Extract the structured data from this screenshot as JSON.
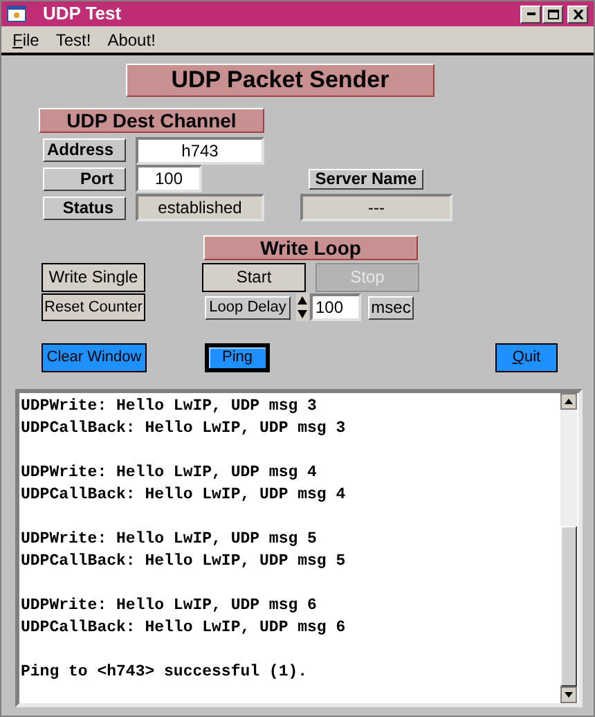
{
  "window": {
    "title": "UDP Test"
  },
  "menu": [
    {
      "label": "File",
      "underline_first": true
    },
    {
      "label": "Test!",
      "underline_first": false
    },
    {
      "label": "About!",
      "underline_first": false
    }
  ],
  "header": "UDP Packet Sender",
  "dest_channel": {
    "title": "UDP Dest Channel",
    "address": {
      "label": "Address",
      "value": "h743"
    },
    "port": {
      "label": "Port",
      "value": "100"
    },
    "status": {
      "label": "Status",
      "value": "established"
    },
    "server_name": {
      "label": "Server Name",
      "value": "---"
    }
  },
  "write_loop": {
    "title": "Write Loop",
    "start": {
      "label": "Start",
      "disabled": false
    },
    "stop": {
      "label": "Stop",
      "disabled": true
    },
    "loop_delay": "Loop Delay",
    "delay_value": "100",
    "unit": "msec"
  },
  "write_single": "Write Single",
  "reset_counter": "Reset Counter",
  "action_buttons": [
    {
      "label": "Clear Window",
      "focused": false,
      "underline_first": false
    },
    {
      "label": "Ping",
      "focused": true,
      "underline_first": false
    },
    {
      "label": "Quit",
      "focused": false,
      "underline_first": true
    }
  ],
  "log": [
    [
      "UDPWrite: Hello LwIP, UDP msg 3",
      "UDPCallBack: Hello LwIP, UDP msg 3"
    ],
    [
      "UDPWrite: Hello LwIP, UDP msg 4",
      "UDPCallBack: Hello LwIP, UDP msg 4"
    ],
    [
      "UDPWrite: Hello LwIP, UDP msg 5",
      "UDPCallBack: Hello LwIP, UDP msg 5"
    ],
    [
      "UDPWrite: Hello LwIP, UDP msg 6",
      "UDPCallBack: Hello LwIP, UDP msg 6"
    ],
    [
      "Ping to <h743> successful (1)."
    ]
  ]
}
